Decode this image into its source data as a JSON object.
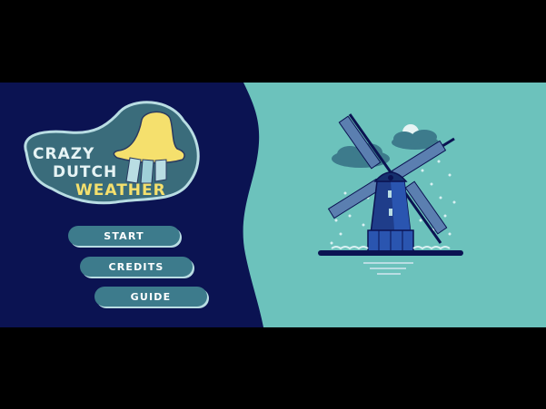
{
  "logo": {
    "line1": "CRAZY",
    "line2": "DUTCH",
    "line3": "WEATHER"
  },
  "menu": {
    "start_label": "START",
    "credits_label": "CREDITS",
    "guide_label": "GUIDE"
  },
  "colors": {
    "left_panel": "#0b1352",
    "right_panel": "#6cc2bc",
    "button": "#3d7b8c",
    "logo_yellow": "#f5e06d",
    "windmill_blue": "#1f3d8a"
  },
  "icons": [
    "rain-hat-icon",
    "windmill-icon",
    "cloud-icon",
    "moon-icon"
  ]
}
